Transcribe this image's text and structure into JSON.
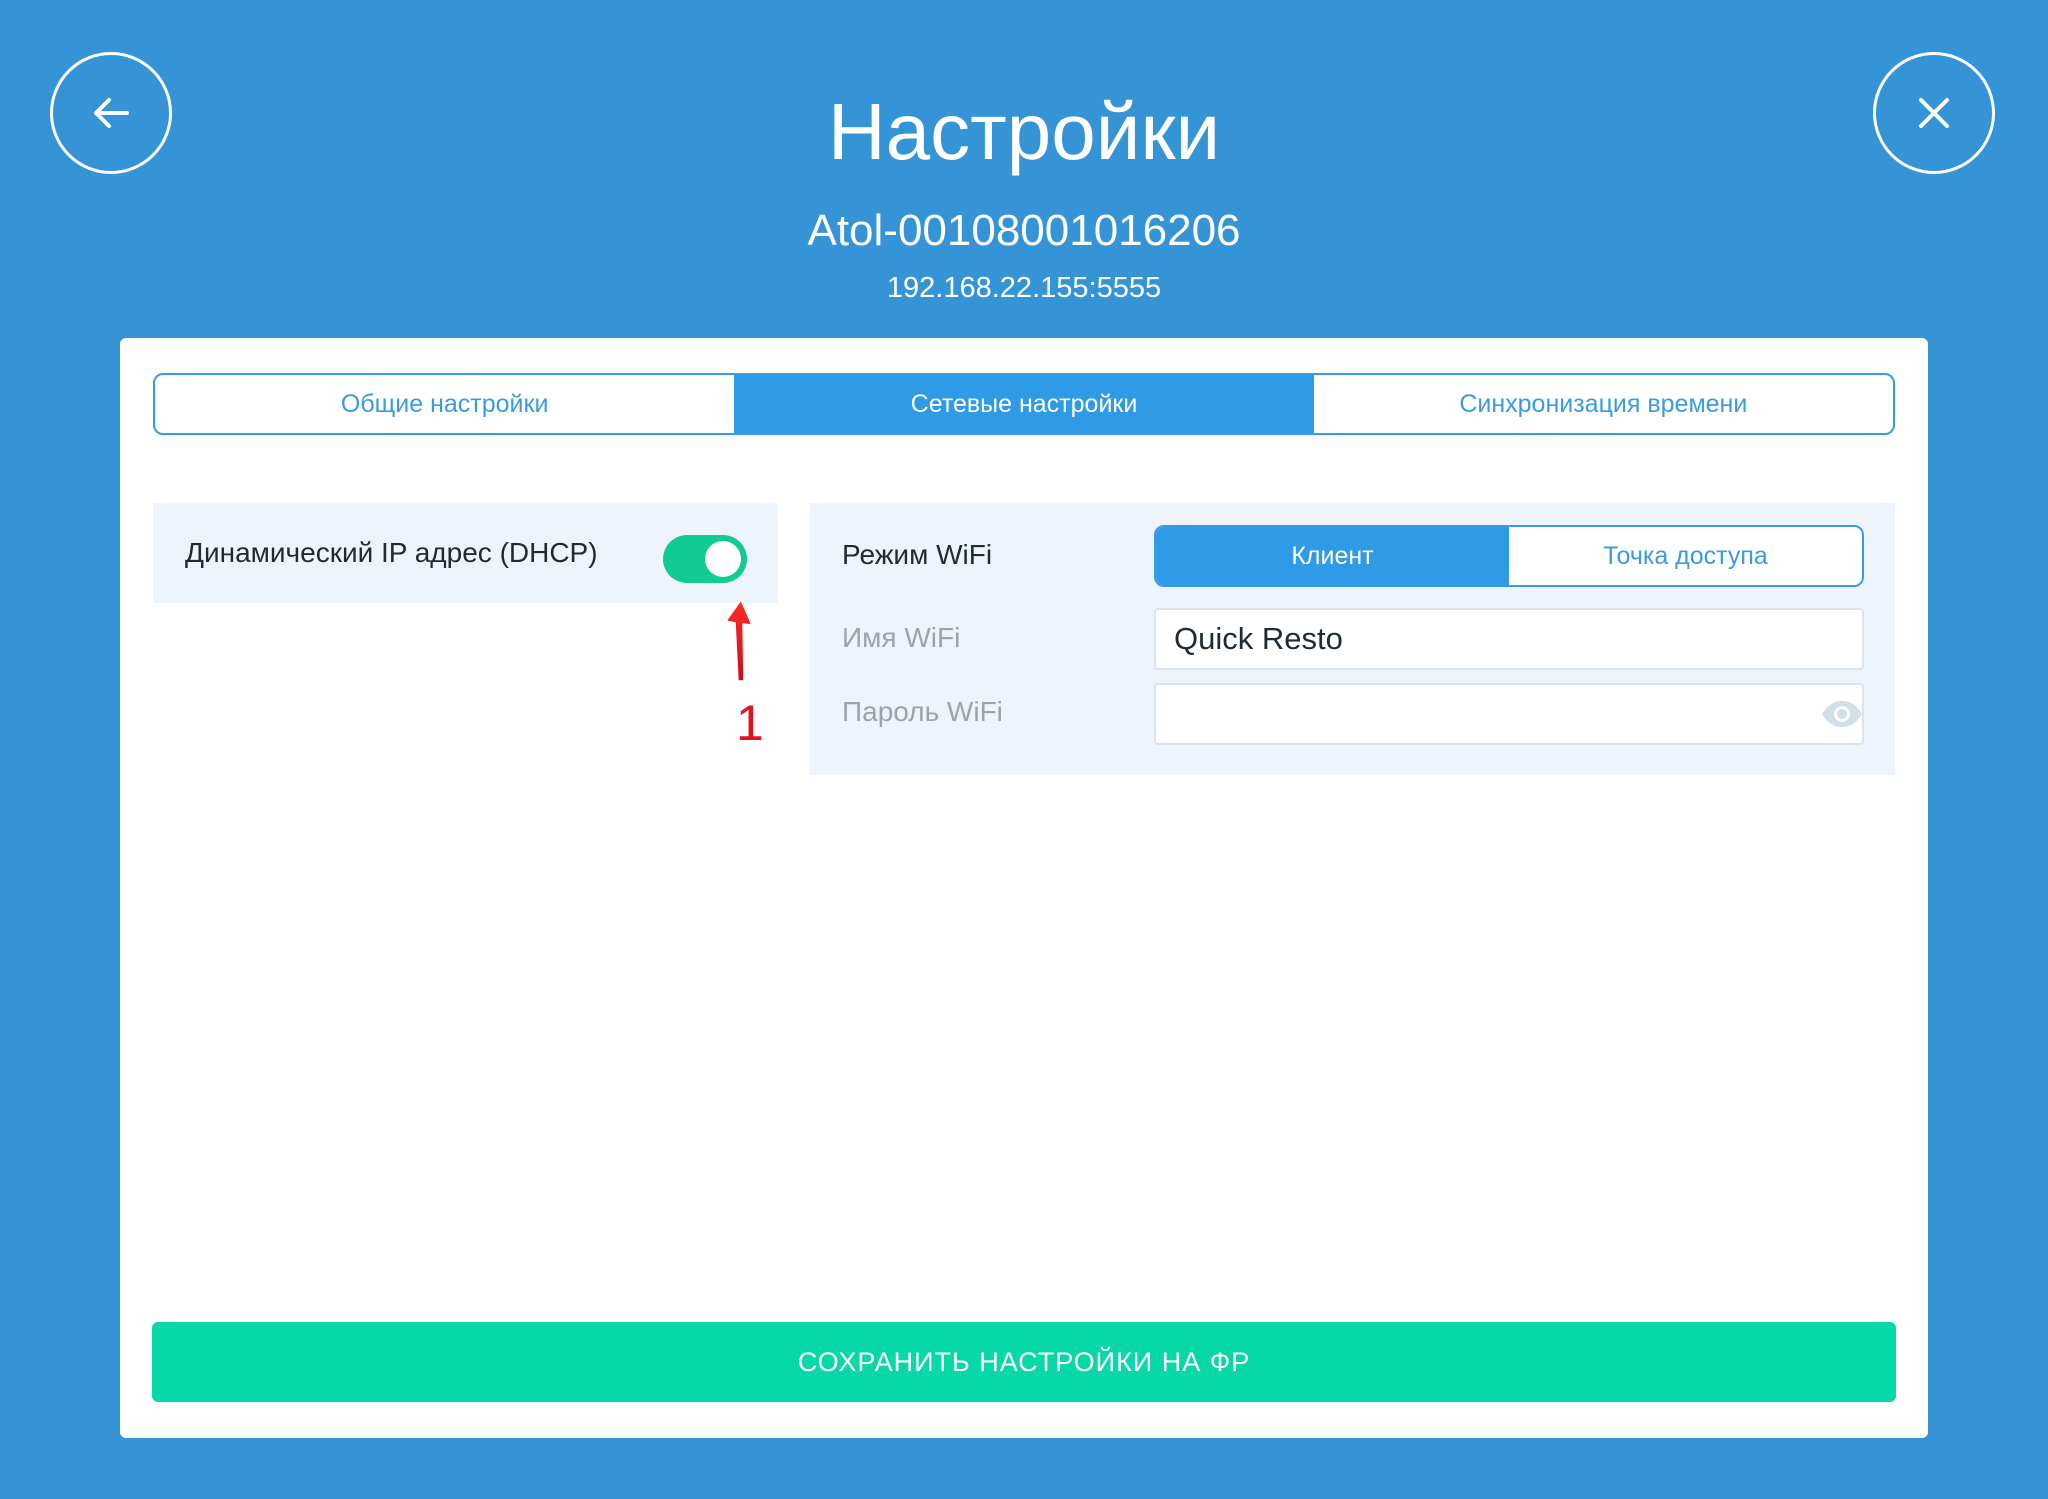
{
  "header": {
    "title": "Настройки",
    "device_name": "Atol-00108001016206",
    "device_address": "192.168.22.155:5555",
    "back_icon": "arrow-left-icon",
    "close_icon": "close-icon"
  },
  "tabs": [
    {
      "label": "Общие настройки",
      "active": false
    },
    {
      "label": "Сетевые настройки",
      "active": true
    },
    {
      "label": "Синхронизация времени",
      "active": false
    }
  ],
  "dhcp": {
    "label": "Динамический IP адрес (DHCP)",
    "enabled": true
  },
  "wifi": {
    "mode_label": "Режим WiFi",
    "modes": [
      {
        "label": "Клиент",
        "active": true
      },
      {
        "label": "Точка доступа",
        "active": false
      }
    ],
    "name_label": "Имя WiFi",
    "name_value": "Quick Resto",
    "password_label": "Пароль WiFi",
    "password_value": "",
    "password_icon": "eye-icon"
  },
  "annotation": {
    "number": "1"
  },
  "save_button": {
    "label": "СОХРАНИТЬ НАСТРОЙКИ НА ФР"
  },
  "colors": {
    "background": "#3594d6",
    "accent": "#2f9ae6",
    "toggle_on": "#10cc93",
    "save_button": "#07d8a8",
    "annotation": "#e3141e"
  }
}
